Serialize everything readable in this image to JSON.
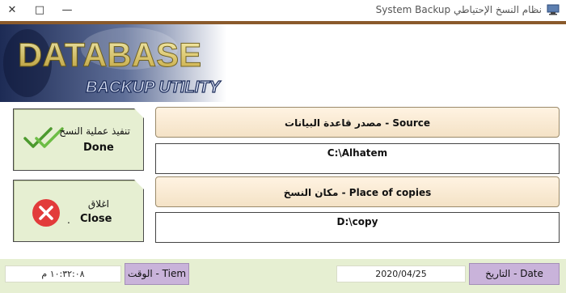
{
  "window": {
    "title": "System Backup نظام النسخ الإحتياطي",
    "controls": [
      "✕",
      "□",
      "—"
    ]
  },
  "banner": {
    "title_line1": "DATABASE",
    "title_line2": "BACKUP UTILITY"
  },
  "actions": {
    "done": {
      "label_ar": "تنفيذ عملية النسخ",
      "label_en": "Done",
      "icon": "check-icon"
    },
    "close": {
      "label_ar": "اغلاق",
      "label_en": "Close",
      "icon": "error-x-icon"
    }
  },
  "fields": {
    "source": {
      "label": "مصدر قاعدة البيانات - Source",
      "value": "C:\\Alhatem"
    },
    "copies": {
      "label": "مكان النسخ - Place of copies",
      "value": "D:\\copy"
    }
  },
  "footer": {
    "time_label": "الوقت - Tiem",
    "time_value": "١٠:٣٢:٠٨ م",
    "date_label": "التاريخ - Date",
    "date_value": "2020/04/25"
  },
  "colors": {
    "accent_green": "#e6efd2",
    "label_purple": "#c9b3da",
    "label_beige": "#f4e2c6",
    "strip_brown": "#8a5a2b"
  }
}
